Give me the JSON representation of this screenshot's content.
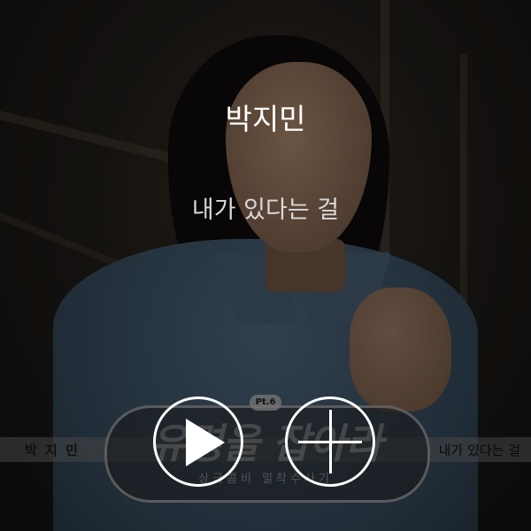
{
  "player": {
    "artist": "박지민",
    "song_title": "내가 있다는 걸"
  },
  "cover_art": {
    "band_left_text": "박 지 민",
    "band_right_text": "내가 있다는 걸",
    "logo_title": "유령을 잡아라",
    "logo_subtitle": "상극콤비 밀착수사기",
    "logo_part": "Pt.6"
  },
  "controls": {
    "play_icon": "play-icon",
    "add_icon": "plus-icon",
    "icon_color": "#ffffff"
  }
}
